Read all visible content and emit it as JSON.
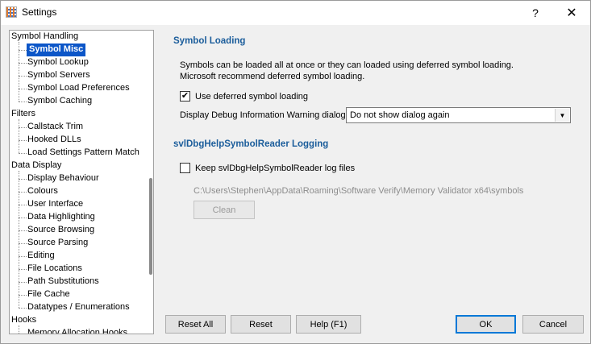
{
  "window": {
    "title": "Settings",
    "help_glyph": "?",
    "close_glyph": "✕"
  },
  "tree": {
    "items": [
      {
        "label": "Symbol Handling",
        "level": 0
      },
      {
        "label": "Symbol Misc",
        "level": 1,
        "selected": true
      },
      {
        "label": "Symbol Lookup",
        "level": 1
      },
      {
        "label": "Symbol Servers",
        "level": 1
      },
      {
        "label": "Symbol Load Preferences",
        "level": 1
      },
      {
        "label": "Symbol Caching",
        "level": 1
      },
      {
        "label": "Filters",
        "level": 0
      },
      {
        "label": "Callstack Trim",
        "level": 1
      },
      {
        "label": "Hooked DLLs",
        "level": 1
      },
      {
        "label": "Load Settings Pattern Match",
        "level": 1
      },
      {
        "label": "Data Display",
        "level": 0
      },
      {
        "label": "Display Behaviour",
        "level": 1
      },
      {
        "label": "Colours",
        "level": 1
      },
      {
        "label": "User Interface",
        "level": 1
      },
      {
        "label": "Data Highlighting",
        "level": 1
      },
      {
        "label": "Source Browsing",
        "level": 1
      },
      {
        "label": "Source Parsing",
        "level": 1
      },
      {
        "label": "Editing",
        "level": 1
      },
      {
        "label": "File Locations",
        "level": 1
      },
      {
        "label": "Path Substitutions",
        "level": 1
      },
      {
        "label": "File Cache",
        "level": 1
      },
      {
        "label": "Datatypes / Enumerations",
        "level": 1
      },
      {
        "label": "Hooks",
        "level": 0
      },
      {
        "label": "Memory Allocation Hooks",
        "level": 1
      }
    ]
  },
  "symbol_loading": {
    "title": "Symbol Loading",
    "description_line1": "Symbols can be loaded all at once or they can loaded using deferred symbol loading.",
    "description_line2": "Microsoft recommend deferred symbol loading.",
    "deferred_checkbox_label": "Use deferred symbol loading",
    "deferred_checked": true,
    "warning_label": "Display Debug Information Warning dialog",
    "warning_value": "Do not show dialog again"
  },
  "logging": {
    "title": "svlDbgHelpSymbolReader Logging",
    "keep_checkbox_label": "Keep svlDbgHelpSymbolReader log files",
    "keep_checked": false,
    "path": "C:\\Users\\Stephen\\AppData\\Roaming\\Software Verify\\Memory Validator x64\\symbols",
    "clean_label": "Clean"
  },
  "footer": {
    "reset_all": "Reset All",
    "reset": "Reset",
    "help": "Help (F1)",
    "ok": "OK",
    "cancel": "Cancel"
  },
  "icons": {
    "check_glyph": "✔",
    "dropdown_glyph": "▼"
  }
}
